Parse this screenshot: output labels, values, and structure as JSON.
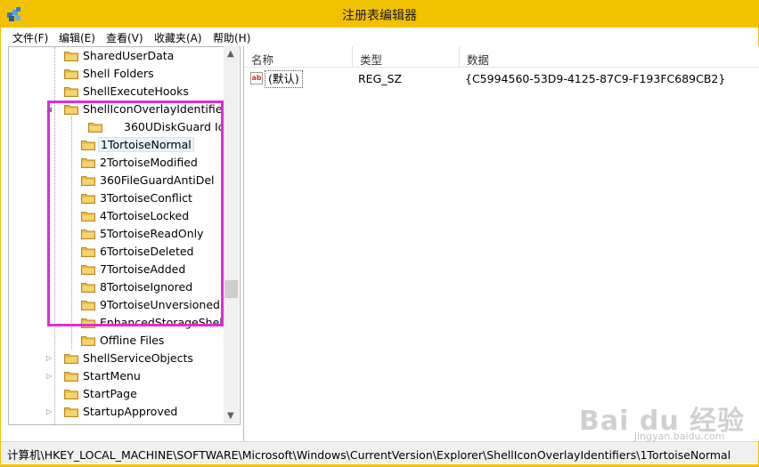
{
  "window": {
    "title": "注册表编辑器"
  },
  "menu": [
    "文件(F)",
    "编辑(E)",
    "查看(V)",
    "收藏夹(A)",
    "帮助(H)"
  ],
  "tree": {
    "items": [
      {
        "label": "SharedUserData",
        "expander": "none"
      },
      {
        "label": "Shell Folders",
        "expander": "none"
      },
      {
        "label": "ShellExecuteHooks",
        "expander": "none"
      },
      {
        "label": "ShellIconOverlayIdentifiers",
        "expander": "expanded"
      },
      {
        "label": "360UDiskGuard Ic",
        "expander": "none"
      },
      {
        "label": "1TortoiseNormal",
        "expander": "none",
        "selected": true
      },
      {
        "label": "2TortoiseModified",
        "expander": "none"
      },
      {
        "label": "360FileGuardAntiDel",
        "expander": "none"
      },
      {
        "label": "3TortoiseConflict",
        "expander": "none"
      },
      {
        "label": "4TortoiseLocked",
        "expander": "none"
      },
      {
        "label": "5TortoiseReadOnly",
        "expander": "none"
      },
      {
        "label": "6TortoiseDeleted",
        "expander": "none"
      },
      {
        "label": "7TortoiseAdded",
        "expander": "none"
      },
      {
        "label": "8TortoiseIgnored",
        "expander": "none"
      },
      {
        "label": "9TortoiseUnversioned",
        "expander": "none"
      },
      {
        "label": "EnhancedStorageShell",
        "expander": "none"
      },
      {
        "label": "Offline Files",
        "expander": "none"
      },
      {
        "label": "ShellServiceObjects",
        "expander": "collapsed"
      },
      {
        "label": "StartMenu",
        "expander": "collapsed"
      },
      {
        "label": "StartPage",
        "expander": "none"
      },
      {
        "label": "StartupApproved",
        "expander": "collapsed"
      }
    ]
  },
  "list": {
    "columns": [
      "名称",
      "类型",
      "数据"
    ],
    "rows": [
      {
        "icon": "string-value-icon",
        "name": "(默认)",
        "type": "REG_SZ",
        "data": "{C5994560-53D9-4125-87C9-F193FC689CB2}"
      }
    ]
  },
  "status": {
    "path": "计算机\\HKEY_LOCAL_MACHINE\\SOFTWARE\\Microsoft\\Windows\\CurrentVersion\\Explorer\\ShellIconOverlayIdentifiers\\1TortoiseNormal"
  },
  "watermark": {
    "text": "Bai du 经验",
    "sub": "jingyan.baidu.com"
  },
  "colors": {
    "titlebar": "#f2c200",
    "highlight": "#e22ad8",
    "folder": "#e8b93a"
  }
}
